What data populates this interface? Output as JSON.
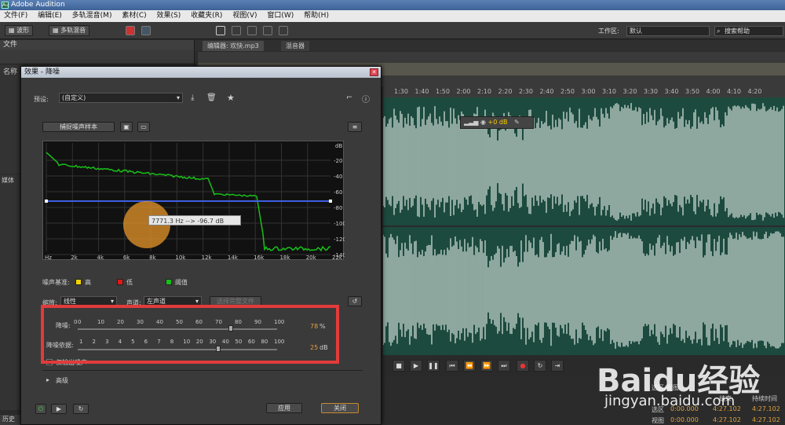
{
  "app": {
    "title": "Adobe Audition"
  },
  "menu": [
    "文件(F)",
    "编辑(E)",
    "多轨混音(M)",
    "素材(C)",
    "效果(S)",
    "收藏夹(R)",
    "视图(V)",
    "窗口(W)",
    "帮助(H)"
  ],
  "toolbar": {
    "waveform_label": "波形",
    "multitrack_label": "多轨混音",
    "workspace_label": "工作区:",
    "workspace_value": "默认",
    "help_search": "搜索帮助"
  },
  "files_panel": {
    "title": "文件",
    "col_name": "名称"
  },
  "media_panel": {
    "title": "媒体"
  },
  "history_tab": "历史",
  "editor": {
    "tab_editor": "编辑器: 欢快.mp3",
    "tab_mixer": "混音器"
  },
  "timeline_marks": [
    "1:30",
    "1:40",
    "1:50",
    "2:00",
    "2:10",
    "2:20",
    "2:30",
    "2:40",
    "2:50",
    "3:00",
    "3:10",
    "3:20",
    "3:30",
    "3:40",
    "3:50",
    "4:00",
    "4:10",
    "4:20"
  ],
  "hud": {
    "value": "+0 dB"
  },
  "selection_view": {
    "header": "选区/视图",
    "col_end": "结束",
    "col_duration": "持续时间",
    "row_selection": "选区",
    "row_view": "视图",
    "sel_start": "0:00.000",
    "sel_end": "4:27.102",
    "sel_duration": "4:27.102",
    "view_start": "0:00.000",
    "view_end": "4:27.102",
    "view_duration": "4:27.102"
  },
  "dialog": {
    "title": "效果 - 降噪",
    "preset_label": "预设:",
    "preset_value": "(自定义)",
    "capture_button": "捕捉噪声样本",
    "graph": {
      "y_unit": "dB",
      "y_ticks": [
        "-20",
        "-40",
        "-60",
        "-80",
        "-100",
        "-120",
        "-140"
      ],
      "x_ticks": [
        "Hz",
        "2k",
        "4k",
        "6k",
        "8k",
        "10k",
        "12k",
        "14k",
        "16k",
        "18k",
        "20k",
        "22k"
      ],
      "tooltip": "7771.3 Hz --> -96.7 dB"
    },
    "legend": {
      "label": "噪声基准:",
      "high": "高",
      "high_color": "#f2d200",
      "low": "低",
      "low_color": "#e01818",
      "threshold": "阈值",
      "threshold_color": "#18c018"
    },
    "scale_label": "缩放:",
    "scale_value": "线性",
    "channel_label": "声道:",
    "channel_value": "左声道",
    "select_all_button": "选择完整文件",
    "noise_reduction": {
      "label": "降噪:",
      "ticks": [
        "0",
        "10",
        "20",
        "30",
        "40",
        "50",
        "60",
        "70",
        "80",
        "90",
        "100"
      ],
      "zero_prefix": "0",
      "value": "78",
      "unit": "%",
      "percent": 78
    },
    "reduce_by": {
      "label": "降噪依据:",
      "ticks": [
        "1",
        "2",
        "3",
        "4",
        "5",
        "6",
        "7",
        "8",
        "10",
        "20",
        "30",
        "40",
        "50",
        "60",
        "80",
        "100"
      ],
      "value": "25",
      "unit": "dB"
    },
    "output_noise_only": "仅输出噪声",
    "advanced": "高级",
    "apply_button": "应用",
    "close_button": "关闭"
  },
  "watermark": {
    "text": "Baidu经验",
    "url": "jingyan.baidu.com"
  }
}
